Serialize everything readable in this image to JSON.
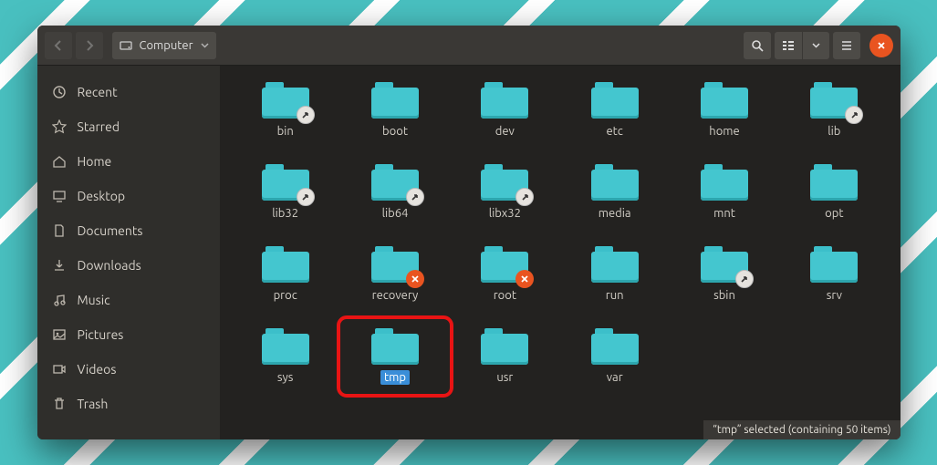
{
  "toolbar": {
    "location_label": "Computer"
  },
  "sidebar": {
    "items": [
      {
        "icon": "recent",
        "label": "Recent"
      },
      {
        "icon": "star",
        "label": "Starred"
      },
      {
        "icon": "home",
        "label": "Home"
      },
      {
        "icon": "desktop",
        "label": "Desktop"
      },
      {
        "icon": "documents",
        "label": "Documents"
      },
      {
        "icon": "downloads",
        "label": "Downloads"
      },
      {
        "icon": "music",
        "label": "Music"
      },
      {
        "icon": "pictures",
        "label": "Pictures"
      },
      {
        "icon": "videos",
        "label": "Videos"
      },
      {
        "icon": "trash",
        "label": "Trash"
      }
    ]
  },
  "folders": [
    {
      "name": "bin",
      "badge": "link"
    },
    {
      "name": "boot"
    },
    {
      "name": "dev"
    },
    {
      "name": "etc"
    },
    {
      "name": "home"
    },
    {
      "name": "lib",
      "badge": "link"
    },
    {
      "name": "lib32",
      "badge": "link"
    },
    {
      "name": "lib64",
      "badge": "link"
    },
    {
      "name": "libx32",
      "badge": "link"
    },
    {
      "name": "media"
    },
    {
      "name": "mnt"
    },
    {
      "name": "opt"
    },
    {
      "name": "proc"
    },
    {
      "name": "recovery",
      "badge": "deny"
    },
    {
      "name": "root",
      "badge": "deny"
    },
    {
      "name": "run"
    },
    {
      "name": "sbin",
      "badge": "link"
    },
    {
      "name": "srv"
    },
    {
      "name": "sys"
    },
    {
      "name": "tmp",
      "selected": true,
      "highlight": true
    },
    {
      "name": "usr"
    },
    {
      "name": "var"
    }
  ],
  "status_text": "“tmp” selected  (containing 50 items)"
}
